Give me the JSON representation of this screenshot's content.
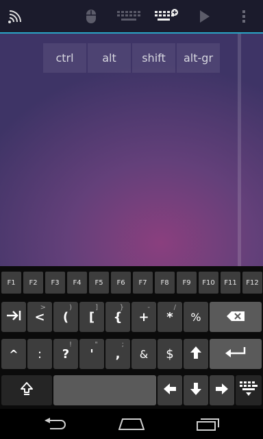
{
  "modifiers": [
    "ctrl",
    "alt",
    "shift",
    "alt-gr"
  ],
  "fkeys": [
    "F1",
    "F2",
    "F3",
    "F4",
    "F5",
    "F6",
    "F7",
    "F8",
    "F9",
    "F10",
    "F11",
    "F12"
  ],
  "row1": [
    {
      "label": "",
      "alt": ""
    },
    {
      "label": "<",
      "alt": ">"
    },
    {
      "label": "(",
      "alt": ")"
    },
    {
      "label": "[",
      "alt": "]"
    },
    {
      "label": "{",
      "alt": "}"
    },
    {
      "label": "+",
      "alt": "-"
    },
    {
      "label": "*",
      "alt": "/"
    },
    {
      "label": "%",
      "alt": ""
    },
    {
      "label": "",
      "alt": ""
    }
  ],
  "row2": [
    {
      "label": "^",
      "alt": ""
    },
    {
      "label": ":",
      "alt": ""
    },
    {
      "label": "?",
      "alt": "!"
    },
    {
      "label": "'",
      "alt": "\""
    },
    {
      "label": ",",
      "alt": ";"
    },
    {
      "label": "&",
      "alt": ""
    },
    {
      "label": "$",
      "alt": ""
    },
    {
      "label": "",
      "alt": ""
    },
    {
      "label": "",
      "alt": ""
    }
  ],
  "icons": {
    "wifi": "wifi-icon",
    "mouse": "mouse-icon",
    "keyboard": "keyboard-icon",
    "keyboard_add": "keyboard-add-icon",
    "play": "play-icon",
    "overflow": "overflow-menu-icon",
    "tab": "tab-key-icon",
    "backspace": "backspace-icon",
    "up": "arrow-up-icon",
    "enter": "enter-icon",
    "shift": "shift-icon",
    "left": "arrow-left-icon",
    "down": "arrow-down-icon",
    "right": "arrow-right-icon",
    "hide_keyboard": "hide-keyboard-icon",
    "nav_back": "nav-back-icon",
    "nav_home": "nav-home-icon",
    "nav_recent": "nav-recents-icon"
  }
}
